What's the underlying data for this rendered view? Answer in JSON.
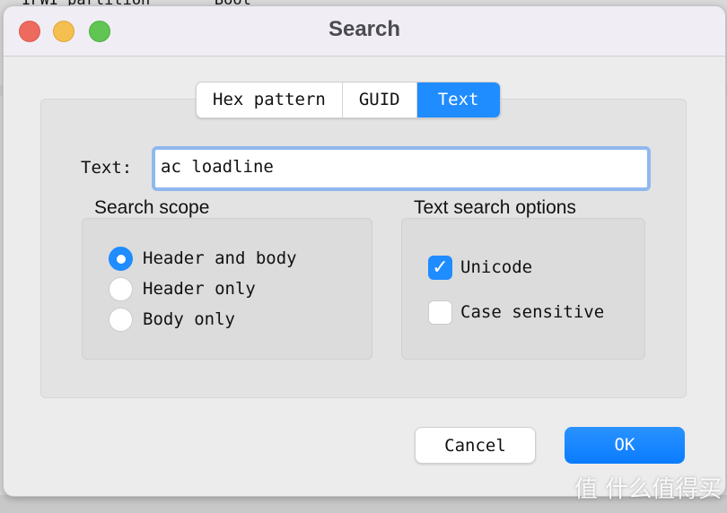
{
  "background": {
    "text": "IFWI partition       Boot"
  },
  "window": {
    "title": "Search"
  },
  "tabs": [
    {
      "label": "Hex pattern"
    },
    {
      "label": "GUID"
    },
    {
      "label": "Text",
      "active": true
    }
  ],
  "text_field": {
    "label": "Text:",
    "value": "ac loadline"
  },
  "search_scope": {
    "title": "Search scope",
    "options": [
      {
        "label": "Header and body",
        "selected": true
      },
      {
        "label": "Header only",
        "selected": false
      },
      {
        "label": "Body only",
        "selected": false
      }
    ]
  },
  "text_options": {
    "title": "Text search options",
    "options": [
      {
        "label": "Unicode",
        "checked": true
      },
      {
        "label": "Case sensitive",
        "checked": false
      }
    ]
  },
  "buttons": {
    "cancel": "Cancel",
    "ok": "OK"
  },
  "colors": {
    "accent": "#1f8cff",
    "close": "#ee6a5f",
    "minimize": "#f5bf4f",
    "zoom": "#61c554"
  },
  "watermark": "值 什么值得买"
}
